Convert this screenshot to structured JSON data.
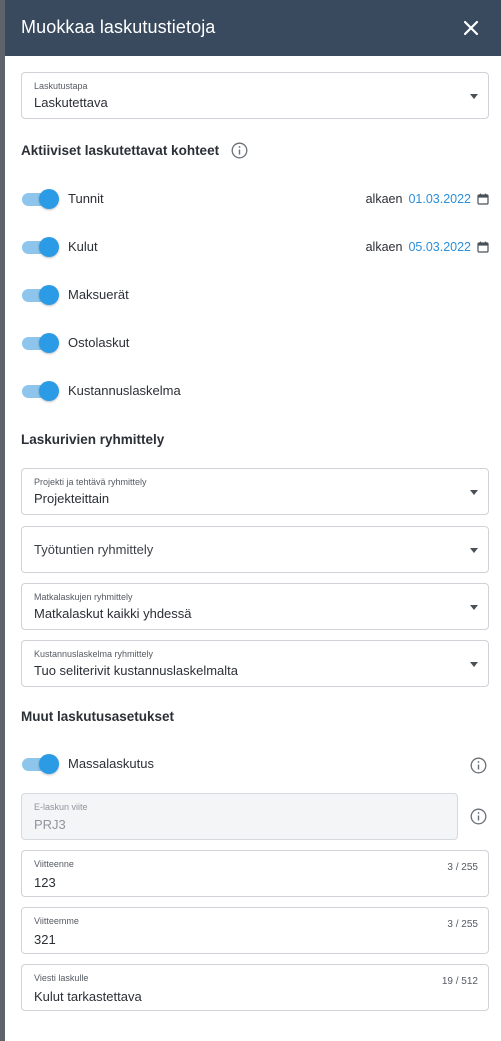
{
  "header": {
    "title": "Muokkaa laskutustietoja"
  },
  "billing_method": {
    "label": "Laskutustapa",
    "value": "Laskutettava"
  },
  "active_section": {
    "title": "Aktiiviset laskutettavat kohteet",
    "items": [
      {
        "label": "Tunnit",
        "enabled": true,
        "date_prefix": "alkaen",
        "date": "01.03.2022"
      },
      {
        "label": "Kulut",
        "enabled": true,
        "date_prefix": "alkaen",
        "date": "05.03.2022"
      },
      {
        "label": "Maksuerät",
        "enabled": true
      },
      {
        "label": "Ostolaskut",
        "enabled": true
      },
      {
        "label": "Kustannuslaskelma",
        "enabled": true
      }
    ]
  },
  "grouping_section": {
    "title": "Laskurivien ryhmittely",
    "project_task": {
      "label": "Projekti ja tehtävä ryhmittely",
      "value": "Projekteittain"
    },
    "work_hours": {
      "placeholder": "Työtuntien ryhmittely"
    },
    "travel": {
      "label": "Matkalaskujen ryhmittely",
      "value": "Matkalaskut kaikki yhdessä"
    },
    "cost_calc": {
      "label": "Kustannuslaskelma ryhmittely",
      "value": "Tuo seliterivit kustannuslaskelmalta"
    }
  },
  "other_section": {
    "title": "Muut laskutusasetukset",
    "mass_billing": {
      "label": "Massalaskutus",
      "enabled": true
    },
    "einvoice_ref": {
      "label": "E-laskun viite",
      "value": "PRJ3"
    },
    "your_ref": {
      "label": "Viitteenne",
      "value": "123",
      "counter": "3 / 255"
    },
    "our_ref": {
      "label": "Viitteemme",
      "value": "321",
      "counter": "3 / 255"
    },
    "message": {
      "label": "Viesti laskulle",
      "value": "Kulut tarkastettava",
      "counter": "19 / 512"
    }
  }
}
